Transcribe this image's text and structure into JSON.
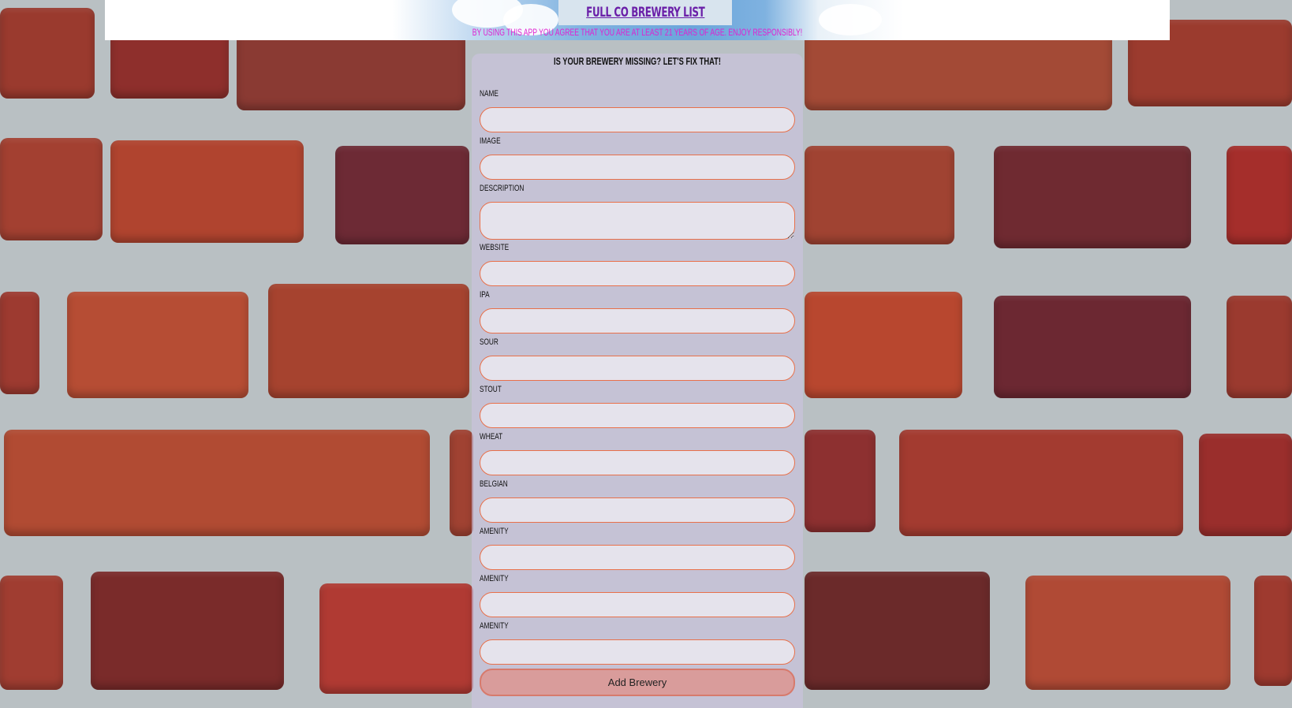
{
  "header": {
    "title": "FULL CO BREWERY LIST",
    "disclaimer": "BY USING THIS APP YOU AGREE THAT YOU ARE AT LEAST 21 YEARS OF AGE. ENJOY RESPONSIBLY!"
  },
  "form": {
    "heading": "IS YOUR BREWERY MISSING? LET'S FIX THAT!",
    "fields": [
      {
        "label": "NAME",
        "value": ""
      },
      {
        "label": "IMAGE",
        "value": ""
      },
      {
        "label": "DESCRIPTION",
        "value": ""
      },
      {
        "label": "WEBSITE",
        "value": ""
      },
      {
        "label": "IPA",
        "value": ""
      },
      {
        "label": "SOUR",
        "value": ""
      },
      {
        "label": "STOUT",
        "value": ""
      },
      {
        "label": "WHEAT",
        "value": ""
      },
      {
        "label": "BELGIAN",
        "value": ""
      },
      {
        "label": "AMENITY",
        "value": ""
      },
      {
        "label": "AMENITY",
        "value": ""
      },
      {
        "label": "AMENITY",
        "value": ""
      }
    ],
    "submit_label": "Add Brewery"
  },
  "colors": {
    "title": "#6a1fa8",
    "disclaimer": "#e020d0",
    "input_border": "#e8704a",
    "button_bg": "#e18c82"
  }
}
